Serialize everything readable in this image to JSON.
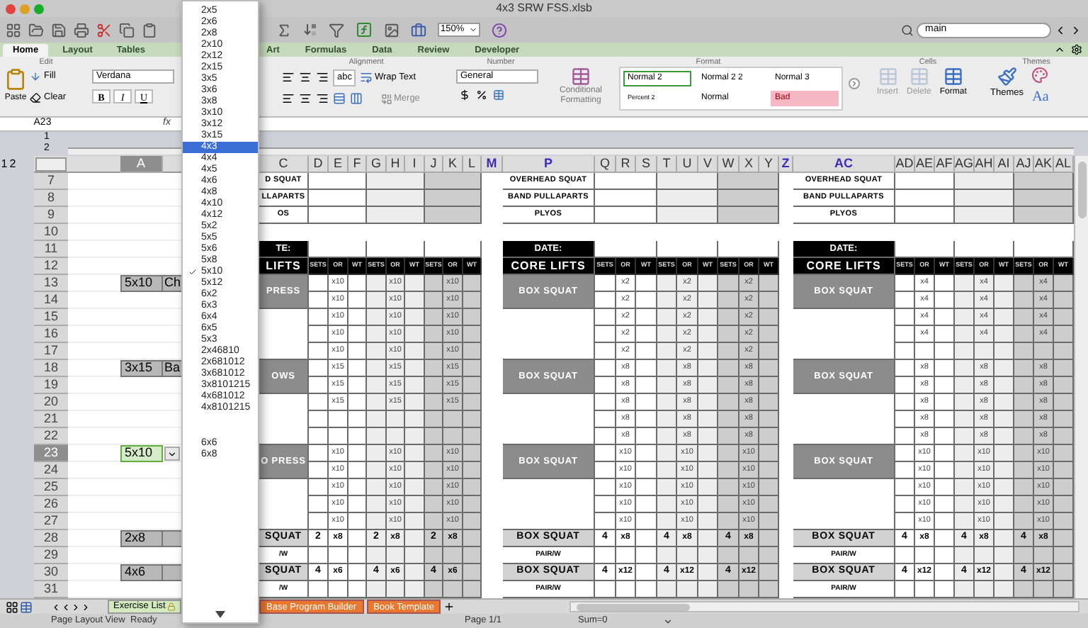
{
  "window": {
    "title": "4x3 SRW FSS.xlsb"
  },
  "toolbar": {
    "zoom": "150%",
    "search": {
      "value": "main"
    }
  },
  "ribbon": {
    "tabs": [
      {
        "label": "Home",
        "selected": true
      },
      {
        "label": "Layout",
        "selected": false
      },
      {
        "label": "Tables",
        "selected": false
      },
      {
        "label": "Art",
        "selected": false
      },
      {
        "label": "Formulas",
        "selected": false
      },
      {
        "label": "Data",
        "selected": false
      },
      {
        "label": "Review",
        "selected": false
      },
      {
        "label": "Developer",
        "selected": false
      }
    ],
    "edit": {
      "title": "Edit",
      "paste": "Paste",
      "fill": "Fill",
      "clear": "Clear"
    },
    "font": {
      "name": "Verdana",
      "bold": "B",
      "italic": "I",
      "underline": "U"
    },
    "alignment": {
      "title": "Alignment",
      "orientation": "abc",
      "wrap_text": "Wrap Text",
      "merge": "Merge"
    },
    "number": {
      "title": "Number",
      "format": "General"
    },
    "format": {
      "title": "Format",
      "conditional_formatting": "Conditional Formatting",
      "styles": [
        {
          "label": "Normal 2",
          "kind": "normal",
          "selected": true
        },
        {
          "label": "Normal 2 2",
          "kind": "normal",
          "selected": false
        },
        {
          "label": "Normal 3",
          "kind": "normal",
          "selected": false
        },
        {
          "label": "Percent 2",
          "kind": "small",
          "selected": false
        },
        {
          "label": "Normal",
          "kind": "normal",
          "selected": false
        },
        {
          "label": "Bad",
          "kind": "bad",
          "selected": false
        }
      ]
    },
    "cells": {
      "title": "Cells",
      "buttons": [
        {
          "label": "Insert",
          "disabled": true
        },
        {
          "label": "Delete",
          "disabled": true
        },
        {
          "label": "Format",
          "disabled": false
        }
      ]
    },
    "themes": {
      "title": "Themes",
      "themes": "Themes",
      "fonts": "Aa"
    }
  },
  "formula_bar": {
    "name_box": "A23",
    "fx": "fx"
  },
  "outline": {
    "row_levels": [
      "1",
      "2"
    ],
    "column_levels": [
      "1",
      "2"
    ]
  },
  "sheet": {
    "columns": [
      {
        "label": "A",
        "selected": true,
        "hidden_adjacent": false
      },
      {
        "label": "C",
        "selected": false,
        "hidden_adjacent": false
      },
      {
        "label": "D",
        "selected": false,
        "hidden_adjacent": false
      },
      {
        "label": "E",
        "selected": false,
        "hidden_adjacent": false
      },
      {
        "label": "F",
        "selected": false,
        "hidden_adjacent": false
      },
      {
        "label": "G",
        "selected": false,
        "hidden_adjacent": false
      },
      {
        "label": "H",
        "selected": false,
        "hidden_adjacent": false
      },
      {
        "label": "I",
        "selected": false,
        "hidden_adjacent": false
      },
      {
        "label": "J",
        "selected": false,
        "hidden_adjacent": false
      },
      {
        "label": "K",
        "selected": false,
        "hidden_adjacent": false
      },
      {
        "label": "L",
        "selected": false,
        "hidden_adjacent": false
      },
      {
        "label": "M",
        "selected": false,
        "hidden_adjacent": true
      },
      {
        "label": "P",
        "selected": false,
        "hidden_adjacent": true
      },
      {
        "label": "Q",
        "selected": false,
        "hidden_adjacent": false
      },
      {
        "label": "R",
        "selected": false,
        "hidden_adjacent": false
      },
      {
        "label": "S",
        "selected": false,
        "hidden_adjacent": false
      },
      {
        "label": "T",
        "selected": false,
        "hidden_adjacent": false
      },
      {
        "label": "U",
        "selected": false,
        "hidden_adjacent": false
      },
      {
        "label": "V",
        "selected": false,
        "hidden_adjacent": false
      },
      {
        "label": "W",
        "selected": false,
        "hidden_adjacent": false
      },
      {
        "label": "X",
        "selected": false,
        "hidden_adjacent": false
      },
      {
        "label": "Y",
        "selected": false,
        "hidden_adjacent": false
      },
      {
        "label": "Z",
        "selected": false,
        "hidden_adjacent": true
      },
      {
        "label": "AC",
        "selected": false,
        "hidden_adjacent": true
      },
      {
        "label": "AD",
        "selected": false,
        "hidden_adjacent": false
      },
      {
        "label": "AE",
        "selected": false,
        "hidden_adjacent": false
      },
      {
        "label": "AF",
        "selected": false,
        "hidden_adjacent": false
      },
      {
        "label": "AG",
        "selected": false,
        "hidden_adjacent": false
      },
      {
        "label": "AH",
        "selected": false,
        "hidden_adjacent": false
      },
      {
        "label": "AI",
        "selected": false,
        "hidden_adjacent": false
      },
      {
        "label": "AJ",
        "selected": false,
        "hidden_adjacent": false
      },
      {
        "label": "AK",
        "selected": false,
        "hidden_adjacent": false
      },
      {
        "label": "AL",
        "selected": false,
        "hidden_adjacent": false
      }
    ],
    "rows": [
      {
        "number": "7",
        "selected": false
      },
      {
        "number": "8",
        "selected": false
      },
      {
        "number": "9",
        "selected": false
      },
      {
        "number": "10",
        "selected": false
      },
      {
        "number": "11",
        "selected": false
      },
      {
        "number": "12",
        "selected": false
      },
      {
        "number": "13",
        "selected": false,
        "a": "5x10",
        "b": "Ch"
      },
      {
        "number": "14",
        "selected": false
      },
      {
        "number": "15",
        "selected": false
      },
      {
        "number": "16",
        "selected": false
      },
      {
        "number": "17",
        "selected": false
      },
      {
        "number": "18",
        "selected": false,
        "a": "3x15",
        "b": "Ba"
      },
      {
        "number": "19",
        "selected": false
      },
      {
        "number": "20",
        "selected": false
      },
      {
        "number": "21",
        "selected": false
      },
      {
        "number": "22",
        "selected": false
      },
      {
        "number": "23",
        "selected": true,
        "a": "5x10"
      },
      {
        "number": "24",
        "selected": false
      },
      {
        "number": "25",
        "selected": false
      },
      {
        "number": "26",
        "selected": false
      },
      {
        "number": "27",
        "selected": false
      },
      {
        "number": "28",
        "selected": false,
        "a": "2x8"
      },
      {
        "number": "29",
        "selected": false
      },
      {
        "number": "30",
        "selected": false,
        "a": "4x6"
      },
      {
        "number": "31",
        "selected": false
      }
    ],
    "blocks": [
      {
        "top_labels": [
          "D SQUAT",
          "LLAPARTS",
          "OS"
        ],
        "date_label": "TE:",
        "lifts_label": "LIFTS",
        "subheaders": [
          "SETS",
          "OR",
          "WT",
          "SETS",
          "OR",
          "WT",
          "SETS",
          "OR",
          "WT"
        ],
        "groups": [
          {
            "label": "PRESS",
            "rows": [
              [
                "x10",
                "x10",
                "x10"
              ],
              [
                "x10",
                "x10",
                "x10"
              ],
              [
                "x10",
                "x10",
                "x10"
              ],
              [
                "x10",
                "x10",
                "x10"
              ],
              [
                "x10",
                "x10",
                "x10"
              ]
            ]
          },
          {
            "label": "OWS",
            "rows": [
              [
                "x15",
                "x15",
                "x15"
              ],
              [
                "x15",
                "x15",
                "x15"
              ],
              [
                "x15",
                "x15",
                "x15"
              ],
              null,
              null
            ]
          },
          {
            "label": "O PRESS",
            "rows": [
              [
                "x10",
                "x10",
                "x10"
              ],
              [
                "x10",
                "x10",
                "x10"
              ],
              [
                "x10",
                "x10",
                "x10"
              ],
              [
                "x10",
                "x10",
                "x10"
              ],
              [
                "x10",
                "x10",
                "x10"
              ]
            ]
          }
        ],
        "accessories": [
          {
            "label": "SQUAT",
            "note": "/W",
            "sessions": [
              {
                "sets": "2",
                "reps": "x8"
              },
              {
                "sets": "2",
                "reps": "x8"
              },
              {
                "sets": "2",
                "reps": "x8"
              }
            ]
          },
          {
            "label": "SQUAT",
            "note": "/W",
            "sessions": [
              {
                "sets": "4",
                "reps": "x6"
              },
              {
                "sets": "4",
                "reps": "x6"
              },
              {
                "sets": "4",
                "reps": "x6"
              }
            ]
          }
        ]
      },
      {
        "top_labels": [
          "OVERHEAD SQUAT",
          "BAND PULLAPARTS",
          "PLYOS"
        ],
        "date_label": "DATE:",
        "lifts_label": "CORE LIFTS",
        "subheaders": [
          "SETS",
          "OR",
          "WT",
          "SETS",
          "OR",
          "WT",
          "SETS",
          "OR",
          "WT"
        ],
        "groups": [
          {
            "label": "BOX SQUAT",
            "rows": [
              [
                "x2",
                "x2",
                "x2"
              ],
              [
                "x2",
                "x2",
                "x2"
              ],
              [
                "x2",
                "x2",
                "x2"
              ],
              [
                "x2",
                "x2",
                "x2"
              ],
              [
                "x2",
                "x2",
                "x2"
              ]
            ]
          },
          {
            "label": "BOX SQUAT",
            "rows": [
              [
                "x8",
                "x8",
                "x8"
              ],
              [
                "x8",
                "x8",
                "x8"
              ],
              [
                "x8",
                "x8",
                "x8"
              ],
              [
                "x8",
                "x8",
                "x8"
              ],
              [
                "x8",
                "x8",
                "x8"
              ]
            ]
          },
          {
            "label": "BOX SQUAT",
            "rows": [
              [
                "x10",
                "x10",
                "x10"
              ],
              [
                "x10",
                "x10",
                "x10"
              ],
              [
                "x10",
                "x10",
                "x10"
              ],
              [
                "x10",
                "x10",
                "x10"
              ],
              [
                "x10",
                "x10",
                "x10"
              ]
            ]
          }
        ],
        "accessories": [
          {
            "label": "BOX SQUAT",
            "note": "PAIR/W",
            "sessions": [
              {
                "sets": "4",
                "reps": "x8"
              },
              {
                "sets": "4",
                "reps": "x8"
              },
              {
                "sets": "4",
                "reps": "x8"
              }
            ]
          },
          {
            "label": "BOX SQUAT",
            "note": "PAIR/W",
            "sessions": [
              {
                "sets": "4",
                "reps": "x12"
              },
              {
                "sets": "4",
                "reps": "x12"
              },
              {
                "sets": "4",
                "reps": "x12"
              }
            ]
          }
        ]
      },
      {
        "top_labels": [
          "OVERHEAD SQUAT",
          "BAND PULLAPARTS",
          "PLYOS"
        ],
        "date_label": "DATE:",
        "lifts_label": "CORE LIFTS",
        "subheaders": [
          "SETS",
          "OR",
          "WT",
          "SETS",
          "OR",
          "WT",
          "SETS",
          "OR",
          "WT"
        ],
        "groups": [
          {
            "label": "BOX SQUAT",
            "rows": [
              [
                "x4",
                "x4",
                "x4"
              ],
              [
                "x4",
                "x4",
                "x4"
              ],
              [
                "x4",
                "x4",
                "x4"
              ],
              [
                "x4",
                "x4",
                "x4"
              ],
              null
            ]
          },
          {
            "label": "BOX SQUAT",
            "rows": [
              [
                "x8",
                "x8",
                "x8"
              ],
              [
                "x8",
                "x8",
                "x8"
              ],
              [
                "x8",
                "x8",
                "x8"
              ],
              [
                "x8",
                "x8",
                "x8"
              ],
              [
                "x8",
                "x8",
                "x8"
              ]
            ]
          },
          {
            "label": "BOX SQUAT",
            "rows": [
              [
                "x10",
                "x10",
                "x10"
              ],
              [
                "x10",
                "x10",
                "x10"
              ],
              [
                "x10",
                "x10",
                "x10"
              ],
              [
                "x10",
                "x10",
                "x10"
              ],
              [
                "x10",
                "x10",
                "x10"
              ]
            ]
          }
        ],
        "accessories": [
          {
            "label": "BOX SQUAT",
            "note": "PAIR/W",
            "sessions": [
              {
                "sets": "4",
                "reps": "x8"
              },
              {
                "sets": "4",
                "reps": "x8"
              },
              {
                "sets": "4",
                "reps": "x8"
              }
            ]
          },
          {
            "label": "BOX SQUAT",
            "note": "PAIR/W",
            "sessions": [
              {
                "sets": "4",
                "reps": "x12"
              },
              {
                "sets": "4",
                "reps": "x12"
              },
              {
                "sets": "4",
                "reps": "x12"
              }
            ]
          }
        ]
      }
    ]
  },
  "dropdown": {
    "sections": [
      {
        "items": [
          {
            "label": "2x5",
            "selected": false,
            "checked": false
          },
          {
            "label": "2x6",
            "selected": false,
            "checked": false
          },
          {
            "label": "2x8",
            "selected": false,
            "checked": false
          },
          {
            "label": "2x10",
            "selected": false,
            "checked": false
          },
          {
            "label": "2x12",
            "selected": false,
            "checked": false
          },
          {
            "label": "2x15",
            "selected": false,
            "checked": false
          },
          {
            "label": "3x5",
            "selected": false,
            "checked": false
          },
          {
            "label": "3x6",
            "selected": false,
            "checked": false
          },
          {
            "label": "3x8",
            "selected": false,
            "checked": false
          },
          {
            "label": "3x10",
            "selected": false,
            "checked": false
          },
          {
            "label": "3x12",
            "selected": false,
            "checked": false
          },
          {
            "label": "3x15",
            "selected": false,
            "checked": false
          },
          {
            "label": "4x3",
            "selected": true,
            "checked": false
          },
          {
            "label": "4x4",
            "selected": false,
            "checked": false
          },
          {
            "label": "4x5",
            "selected": false,
            "checked": false
          },
          {
            "label": "4x6",
            "selected": false,
            "checked": false
          },
          {
            "label": "4x8",
            "selected": false,
            "checked": false
          },
          {
            "label": "4x10",
            "selected": false,
            "checked": false
          },
          {
            "label": "4x12",
            "selected": false,
            "checked": false
          },
          {
            "label": "5x2",
            "selected": false,
            "checked": false
          },
          {
            "label": "5x5",
            "selected": false,
            "checked": false
          },
          {
            "label": "5x6",
            "selected": false,
            "checked": false
          },
          {
            "label": "5x8",
            "selected": false,
            "checked": false
          },
          {
            "label": "5x10",
            "selected": false,
            "checked": true
          },
          {
            "label": "5x12",
            "selected": false,
            "checked": false
          },
          {
            "label": "6x2",
            "selected": false,
            "checked": false
          },
          {
            "label": "6x3",
            "selected": false,
            "checked": false
          },
          {
            "label": "6x4",
            "selected": false,
            "checked": false
          },
          {
            "label": "6x5",
            "selected": false,
            "checked": false
          },
          {
            "label": "5x3",
            "selected": false,
            "checked": false
          },
          {
            "label": "2x46810",
            "selected": false,
            "checked": false
          },
          {
            "label": "2x681012",
            "selected": false,
            "checked": false
          },
          {
            "label": "3x681012",
            "selected": false,
            "checked": false
          },
          {
            "label": "3x8101215",
            "selected": false,
            "checked": false
          },
          {
            "label": "4x681012",
            "selected": false,
            "checked": false
          },
          {
            "label": "4x8101215",
            "selected": false,
            "checked": false
          }
        ]
      },
      {
        "items": [
          {
            "label": "6x6",
            "selected": false,
            "checked": false
          },
          {
            "label": "6x8",
            "selected": false,
            "checked": false
          }
        ]
      }
    ]
  },
  "sheet_tabs": [
    {
      "label": "Exercise List",
      "color": "#d3eabf"
    },
    {
      "label": "Base Program Builder",
      "color": "#e8782e"
    },
    {
      "label": "Book Template",
      "color": "#e8782e"
    }
  ],
  "status_bar": {
    "view": "Page Layout View",
    "state": "Ready",
    "page": "Page 1/1",
    "sum": "Sum=0"
  }
}
